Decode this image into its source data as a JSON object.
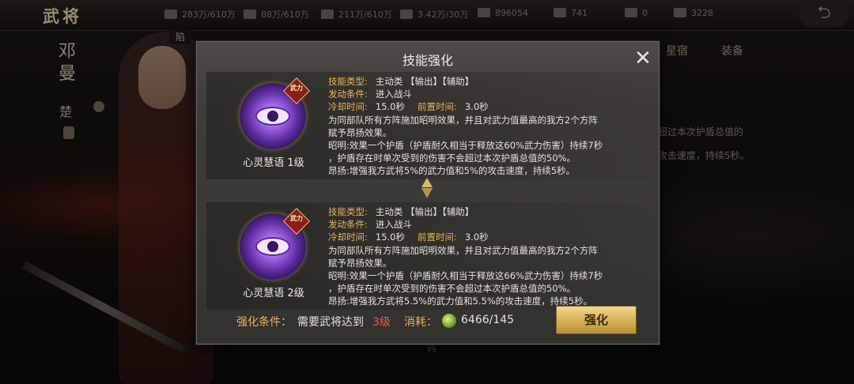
{
  "topbar": {
    "title": "武将",
    "resources": [
      {
        "icon": "grain-icon",
        "value": "283万/610万"
      },
      {
        "icon": "wood-icon",
        "value": "88万/610万"
      },
      {
        "icon": "stone-icon",
        "value": "211万/610万"
      },
      {
        "icon": "iron-icon",
        "value": "3.42万/30万"
      },
      {
        "icon": "coin-icon",
        "value": "896054"
      },
      {
        "icon": "copper-icon",
        "value": "741"
      },
      {
        "icon": "gold-icon",
        "value": "0"
      },
      {
        "icon": "silver-icon",
        "value": "3228"
      }
    ]
  },
  "hero": {
    "name_line1": "邓",
    "name_line2": "曼",
    "faction": "楚",
    "side_box": "陷"
  },
  "background": {
    "tab1": "星宿",
    "tab2": "装备",
    "note1": "超过本次护盾总值的",
    "note2": "攻击速度，持续5秒。",
    "bottom_glyph": "韩"
  },
  "dialog": {
    "title": "技能强化",
    "skills": [
      {
        "icon": "psychic-eye-icon",
        "badge": "武力",
        "name": "心灵慧语 1级",
        "type_label": "技能类型:",
        "type_value": "主动类 【输出】【辅助】",
        "trigger_label": "发动条件:",
        "trigger_value": "进入战斗",
        "cooldown_label": "冷却时间:",
        "cooldown_value": "15.0秒",
        "precast_label": "前置时间:",
        "precast_value": "3.0秒",
        "description": "为同部队所有方阵施加昭明效果，并且对武力值最高的我方2个方阵\n赋予昂扬效果。\n昭明:效果一个护盾（护盾耐久相当于释放这60%武力伤害）持续7秒\n，护盾存在时单次受到的伤害不会超过本次护盾总值的50%。\n昂扬:增强我方武将5%的武力值和5%的攻击速度，持续5秒。"
      },
      {
        "icon": "psychic-eye-icon",
        "badge": "武力",
        "name": "心灵慧语 2级",
        "type_label": "技能类型:",
        "type_value": "主动类 【输出】【辅助】",
        "trigger_label": "发动条件:",
        "trigger_value": "进入战斗",
        "cooldown_label": "冷却时间:",
        "cooldown_value": "15.0秒",
        "precast_label": "前置时间:",
        "precast_value": "3.0秒",
        "description": "为同部队所有方阵施加昭明效果，并且对武力值最高的我方2个方阵\n赋予昂扬效果。\n昭明:效果一个护盾（护盾耐久相当于释放这66%武力伤害）持续7秒\n，护盾存在时单次受到的伤害不会超过本次护盾总值的50%。\n昂扬:增强我方武将5.5%的武力值和5.5%的攻击速度，持续5秒。"
      }
    ],
    "footer": {
      "condition_label": "强化条件：",
      "condition_text": "需要武将达到",
      "condition_level": "3级",
      "cost_label": "消耗：",
      "cost_icon": "jade-coin-icon",
      "cost_value": "6466/145",
      "enhance_label": "强化"
    },
    "close_symbol": "✕"
  },
  "colors": {
    "label": "#e8b25a",
    "level_warning": "#e85a4a",
    "button_gold": "#d9b25a"
  }
}
